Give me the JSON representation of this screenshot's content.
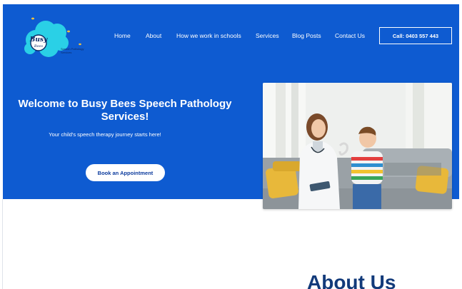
{
  "brand": {
    "logo_text": "Busy Bees",
    "logo_tagline": "Speech Pathology Services"
  },
  "nav": {
    "items": [
      "Home",
      "About",
      "How we work in schools",
      "Services",
      "Blog Posts",
      "Contact Us"
    ],
    "call_label": "Call: 0403 557 443"
  },
  "hero": {
    "title": "Welcome to Busy Bees Speech Pathology Services!",
    "subtitle": "Your child's speech therapy journey starts here!",
    "cta_label": "Book an Appointment"
  },
  "about": {
    "title": "About Us"
  },
  "colors": {
    "hero_bg": "#0e5bd1",
    "logo_cloud": "#2ad0e6",
    "heading_dark": "#123a7a"
  },
  "icons": {
    "logo": "busy-bees-cloud-logo",
    "hero_image": "speech-therapist-with-child-photo"
  }
}
